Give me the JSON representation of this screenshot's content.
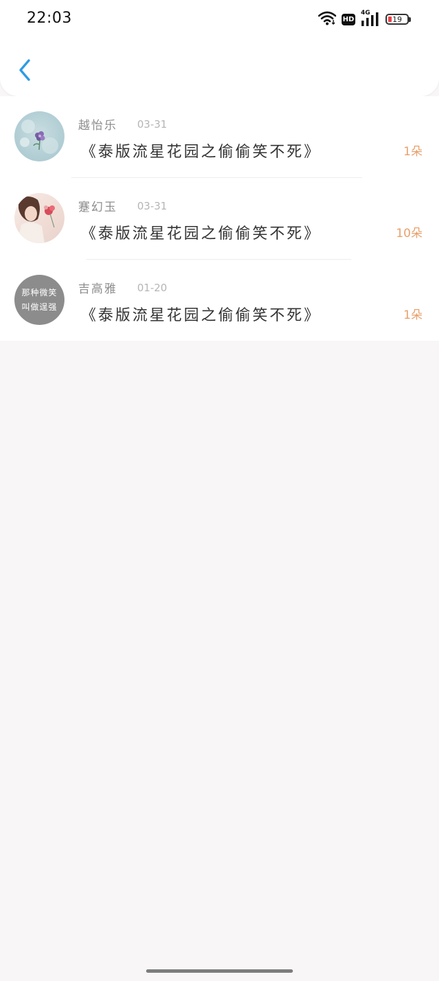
{
  "status_bar": {
    "time": "22:03",
    "network": "4G",
    "hd": "HD",
    "battery": "19",
    "battery_level": 0.19
  },
  "header": {
    "back_icon": "chevron-left-icon",
    "accent_color": "#2e9be6"
  },
  "items": [
    {
      "name": "越怡乐",
      "date": "03-31",
      "title": "《泰版流星花园之偷偷笑不死》",
      "count": "1朵",
      "avatar": "flower-photo"
    },
    {
      "name": "蹇幻玉",
      "date": "03-31",
      "title": "《泰版流星花园之偷偷笑不死》",
      "count": "10朵",
      "avatar": "girl-photo"
    },
    {
      "name": "吉高雅",
      "date": "01-20",
      "title": "《泰版流星花园之偷偷笑不死》",
      "count": "1朵",
      "avatar": "text-avatar",
      "avatar_text": [
        "那种微笑",
        "叫做逞强"
      ]
    }
  ],
  "colors": {
    "count_color": "#e8a06c",
    "background": "#f8f6f7"
  }
}
